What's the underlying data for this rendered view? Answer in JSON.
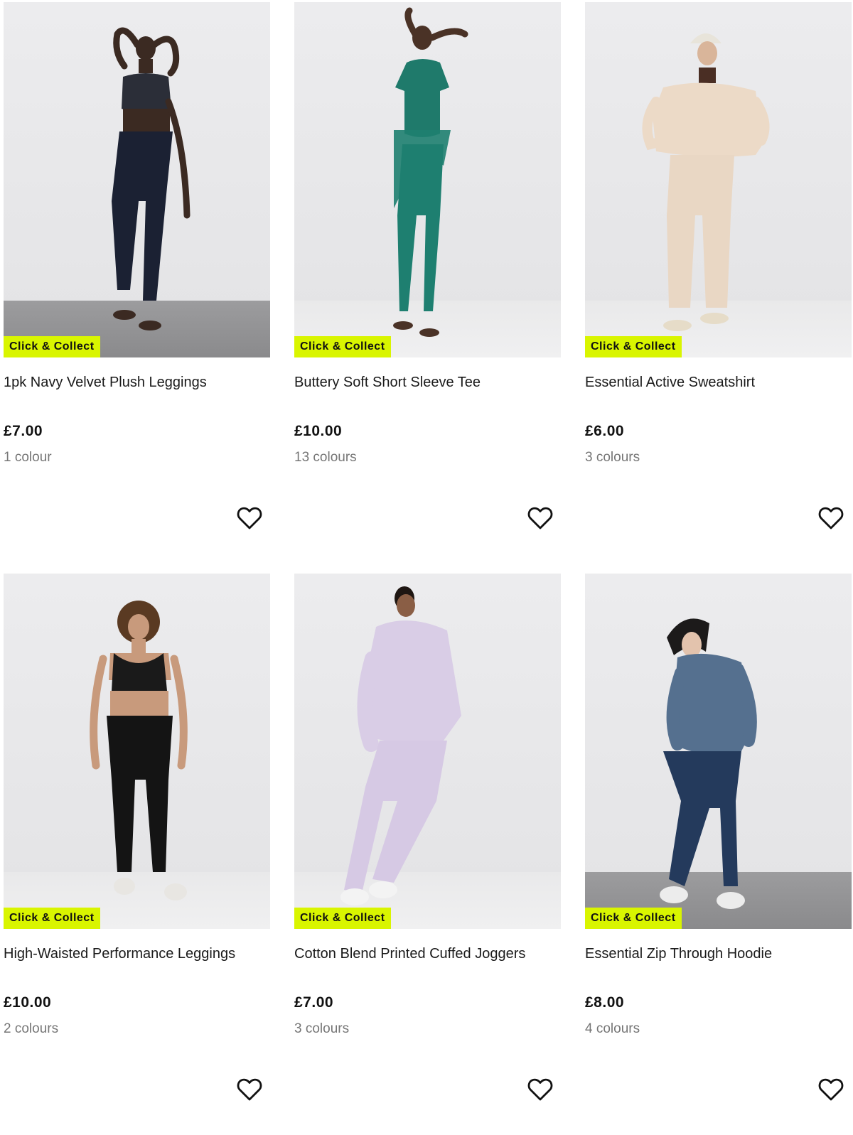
{
  "products": [
    {
      "title": "1pk Navy Velvet Plush Leggings",
      "price": "£7.00",
      "colours": "1 colour",
      "badge": "Click & Collect",
      "top_color": "#2b2e38",
      "bottom_color": "#1b2133",
      "skin_color": "#3b2a22"
    },
    {
      "title": "Buttery Soft Short Sleeve Tee",
      "price": "£10.00",
      "colours": "13 colours",
      "badge": "Click & Collect",
      "top_color": "#1f7a6b",
      "bottom_color": "#1e7f70",
      "skin_color": "#4a3226"
    },
    {
      "title": "Essential Active Sweatshirt",
      "price": "£6.00",
      "colours": "3 colours",
      "badge": "Click & Collect",
      "top_color": "#ecdac7",
      "bottom_color": "#e9d7c4",
      "skin_color": "#d9b59a"
    },
    {
      "title": "High-Waisted Performance Leggings",
      "price": "£10.00",
      "colours": "2 colours",
      "badge": "Click & Collect",
      "top_color": "#1a1a1a",
      "bottom_color": "#141414",
      "skin_color": "#c89a7c"
    },
    {
      "title": "Cotton Blend Printed Cuffed Joggers",
      "price": "£7.00",
      "colours": "3 colours",
      "badge": "Click & Collect",
      "top_color": "#d9cde6",
      "bottom_color": "#d6c9e4",
      "skin_color": "#8a5e45"
    },
    {
      "title": "Essential Zip Through Hoodie",
      "price": "£8.00",
      "colours": "4 colours",
      "badge": "Click & Collect",
      "top_color": "#55708f",
      "bottom_color": "#243a5c",
      "skin_color": "#e3c3ad"
    }
  ],
  "wishlist_icon": "heart-outline-icon",
  "accent_color": "#d9f500"
}
